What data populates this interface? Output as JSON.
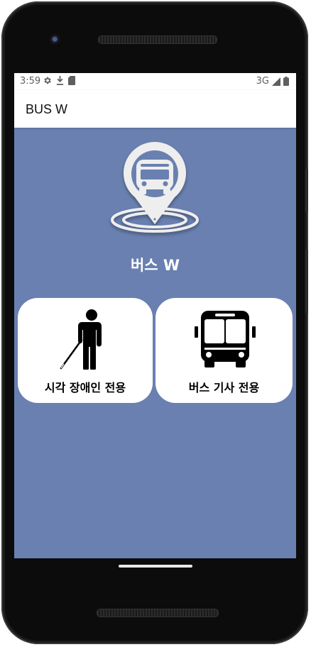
{
  "status_bar": {
    "time": "3:59",
    "left_icons": [
      "settings-icon",
      "download-icon",
      "sd-card-icon"
    ],
    "network": "3G",
    "right_icons": [
      "signal-icon",
      "battery-icon"
    ]
  },
  "app_bar": {
    "title": "BUS W"
  },
  "main": {
    "logo_icon": "bus-location-pin-icon",
    "app_name": "버스 W",
    "background_color": "#6980b0",
    "cards": [
      {
        "label": "시각 장애인 전용",
        "icon": "blind-person-cane-icon"
      },
      {
        "label": "버스 기사 전용",
        "icon": "bus-front-icon"
      }
    ]
  }
}
